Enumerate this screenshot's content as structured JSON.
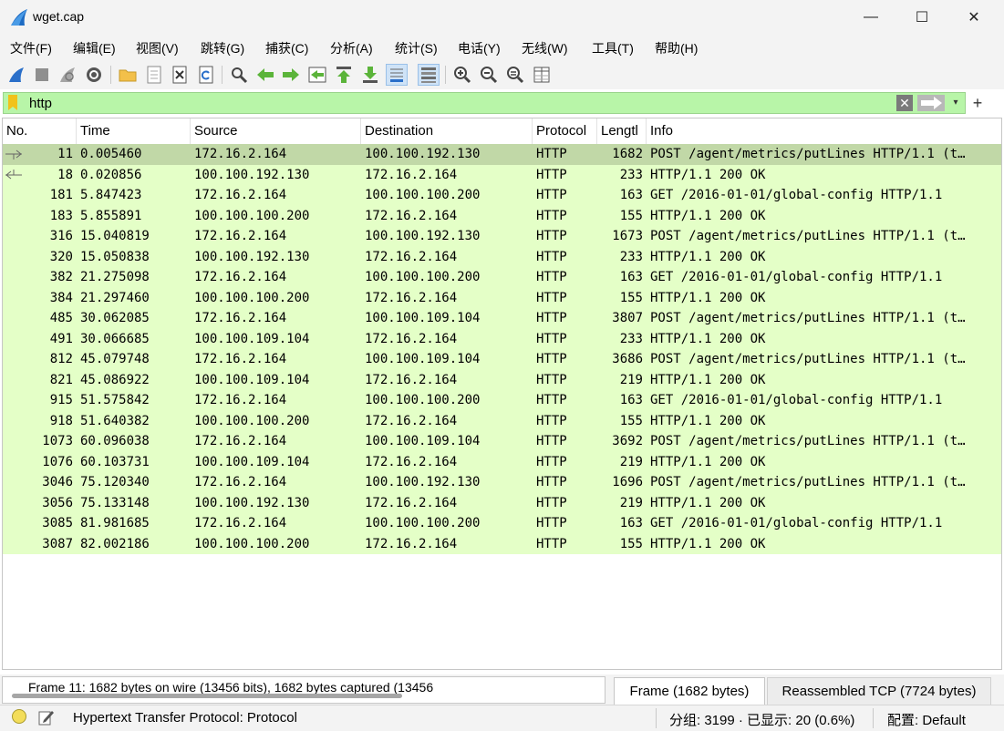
{
  "window": {
    "title": "wget.cap",
    "minimize_glyph": "—",
    "maximize_glyph": "☐",
    "close_glyph": "✕"
  },
  "menu": [
    {
      "label": "文件(F)"
    },
    {
      "label": "编辑(E)"
    },
    {
      "label": "视图(V)"
    },
    {
      "label": "跳转(G)"
    },
    {
      "label": "捕获(C)"
    },
    {
      "label": "分析(A)"
    },
    {
      "label": "统计(S)"
    },
    {
      "label": "电话(Y)"
    },
    {
      "label": "无线(W)"
    },
    {
      "label": "工具(T)"
    },
    {
      "label": "帮助(H)"
    }
  ],
  "toolbar": {
    "icons": [
      "start-capture-icon",
      "stop-capture-icon",
      "restart-capture-icon",
      "capture-options-icon",
      "open-file-icon",
      "save-file-icon",
      "close-file-icon",
      "reload-file-icon",
      "find-packet-icon",
      "go-back-icon",
      "go-forward-icon",
      "go-to-packet-icon",
      "go-first-packet-icon",
      "go-last-packet-icon",
      "auto-scroll-icon",
      "colorize-icon",
      "zoom-in-icon",
      "zoom-out-icon",
      "zoom-normal-icon",
      "resize-columns-icon"
    ]
  },
  "filter": {
    "value": "http",
    "clear_glyph": "✕",
    "dropdown_glyph": "▾",
    "plus_glyph": "+",
    "color": "#b8f5a8"
  },
  "columns": [
    {
      "label": "No."
    },
    {
      "label": "Time"
    },
    {
      "label": "Source"
    },
    {
      "label": "Destination"
    },
    {
      "label": "Protocol"
    },
    {
      "label": "Lengtl"
    },
    {
      "label": "Info"
    }
  ],
  "packets": [
    {
      "no": "11",
      "time": "0.005460",
      "source": "172.16.2.164",
      "destination": "100.100.192.130",
      "protocol": "HTTP",
      "length": "1682",
      "info": "POST /agent/metrics/putLines HTTP/1.1  (t…",
      "selected": true,
      "related": "request"
    },
    {
      "no": "18",
      "time": "0.020856",
      "source": "100.100.192.130",
      "destination": "172.16.2.164",
      "protocol": "HTTP",
      "length": "233",
      "info": "HTTP/1.1 200 OK",
      "related": "response"
    },
    {
      "no": "181",
      "time": "5.847423",
      "source": "172.16.2.164",
      "destination": "100.100.100.200",
      "protocol": "HTTP",
      "length": "163",
      "info": "GET /2016-01-01/global-config HTTP/1.1"
    },
    {
      "no": "183",
      "time": "5.855891",
      "source": "100.100.100.200",
      "destination": "172.16.2.164",
      "protocol": "HTTP",
      "length": "155",
      "info": "HTTP/1.1 200 OK"
    },
    {
      "no": "316",
      "time": "15.040819",
      "source": "172.16.2.164",
      "destination": "100.100.192.130",
      "protocol": "HTTP",
      "length": "1673",
      "info": "POST /agent/metrics/putLines HTTP/1.1  (t…"
    },
    {
      "no": "320",
      "time": "15.050838",
      "source": "100.100.192.130",
      "destination": "172.16.2.164",
      "protocol": "HTTP",
      "length": "233",
      "info": "HTTP/1.1 200 OK"
    },
    {
      "no": "382",
      "time": "21.275098",
      "source": "172.16.2.164",
      "destination": "100.100.100.200",
      "protocol": "HTTP",
      "length": "163",
      "info": "GET /2016-01-01/global-config HTTP/1.1"
    },
    {
      "no": "384",
      "time": "21.297460",
      "source": "100.100.100.200",
      "destination": "172.16.2.164",
      "protocol": "HTTP",
      "length": "155",
      "info": "HTTP/1.1 200 OK"
    },
    {
      "no": "485",
      "time": "30.062085",
      "source": "172.16.2.164",
      "destination": "100.100.109.104",
      "protocol": "HTTP",
      "length": "3807",
      "info": "POST /agent/metrics/putLines HTTP/1.1  (t…"
    },
    {
      "no": "491",
      "time": "30.066685",
      "source": "100.100.109.104",
      "destination": "172.16.2.164",
      "protocol": "HTTP",
      "length": "233",
      "info": "HTTP/1.1 200 OK"
    },
    {
      "no": "812",
      "time": "45.079748",
      "source": "172.16.2.164",
      "destination": "100.100.109.104",
      "protocol": "HTTP",
      "length": "3686",
      "info": "POST /agent/metrics/putLines HTTP/1.1  (t…"
    },
    {
      "no": "821",
      "time": "45.086922",
      "source": "100.100.109.104",
      "destination": "172.16.2.164",
      "protocol": "HTTP",
      "length": "219",
      "info": "HTTP/1.1 200 OK"
    },
    {
      "no": "915",
      "time": "51.575842",
      "source": "172.16.2.164",
      "destination": "100.100.100.200",
      "protocol": "HTTP",
      "length": "163",
      "info": "GET /2016-01-01/global-config HTTP/1.1"
    },
    {
      "no": "918",
      "time": "51.640382",
      "source": "100.100.100.200",
      "destination": "172.16.2.164",
      "protocol": "HTTP",
      "length": "155",
      "info": "HTTP/1.1 200 OK"
    },
    {
      "no": "1073",
      "time": "60.096038",
      "source": "172.16.2.164",
      "destination": "100.100.109.104",
      "protocol": "HTTP",
      "length": "3692",
      "info": "POST /agent/metrics/putLines HTTP/1.1  (t…"
    },
    {
      "no": "1076",
      "time": "60.103731",
      "source": "100.100.109.104",
      "destination": "172.16.2.164",
      "protocol": "HTTP",
      "length": "219",
      "info": "HTTP/1.1 200 OK"
    },
    {
      "no": "3046",
      "time": "75.120340",
      "source": "172.16.2.164",
      "destination": "100.100.192.130",
      "protocol": "HTTP",
      "length": "1696",
      "info": "POST /agent/metrics/putLines HTTP/1.1  (t…"
    },
    {
      "no": "3056",
      "time": "75.133148",
      "source": "100.100.192.130",
      "destination": "172.16.2.164",
      "protocol": "HTTP",
      "length": "219",
      "info": "HTTP/1.1 200 OK"
    },
    {
      "no": "3085",
      "time": "81.981685",
      "source": "172.16.2.164",
      "destination": "100.100.100.200",
      "protocol": "HTTP",
      "length": "163",
      "info": "GET /2016-01-01/global-config HTTP/1.1"
    },
    {
      "no": "3087",
      "time": "82.002186",
      "source": "100.100.100.200",
      "destination": "172.16.2.164",
      "protocol": "HTTP",
      "length": "155",
      "info": "HTTP/1.1 200 OK"
    }
  ],
  "row_colors": {
    "http": "#e4ffc7",
    "selected": "#c1d8a7"
  },
  "detail": {
    "summary_text": "Frame 11: 1682 bytes on wire (13456 bits), 1682 bytes captured (13456",
    "tabs": [
      {
        "label": "Frame (1682 bytes)",
        "active": true
      },
      {
        "label": "Reassembled TCP (7724 bytes)",
        "active": false
      }
    ]
  },
  "status": {
    "field_text": "Hypertext Transfer Protocol: Protocol",
    "packets_text": "分组: 3199 · 已显示: 20 (0.6%)",
    "profile_text": "配置: Default"
  }
}
